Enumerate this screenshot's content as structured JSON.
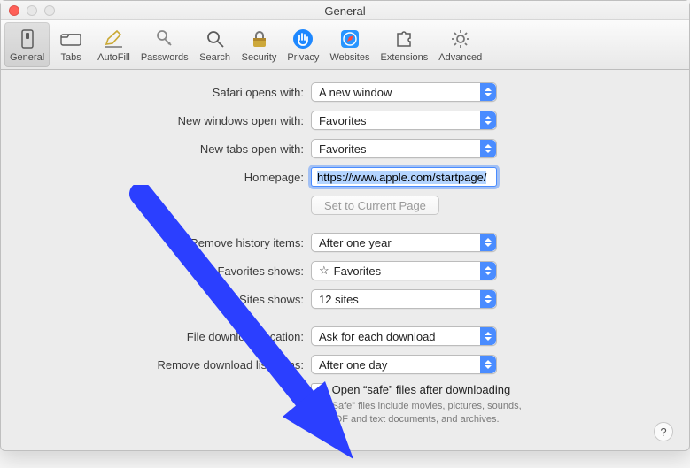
{
  "window": {
    "title": "General"
  },
  "toolbar": [
    {
      "name": "general",
      "label": "General"
    },
    {
      "name": "tabs",
      "label": "Tabs"
    },
    {
      "name": "autofill",
      "label": "AutoFill"
    },
    {
      "name": "passwords",
      "label": "Passwords"
    },
    {
      "name": "search",
      "label": "Search"
    },
    {
      "name": "security",
      "label": "Security"
    },
    {
      "name": "privacy",
      "label": "Privacy"
    },
    {
      "name": "websites",
      "label": "Websites"
    },
    {
      "name": "extensions",
      "label": "Extensions"
    },
    {
      "name": "advanced",
      "label": "Advanced"
    }
  ],
  "labels": {
    "safari_opens_with": "Safari opens with:",
    "new_windows_open": "New windows open with:",
    "new_tabs_open": "New tabs open with:",
    "homepage": "Homepage:",
    "set_current": "Set to Current Page",
    "remove_history": "Remove history items:",
    "favorites_shows": "Favorites shows:",
    "topsites_shows": "Top Sites shows:",
    "file_dl_location": "File download location:",
    "remove_dl_list": "Remove download list items:",
    "open_safe_files": "Open “safe” files after downloading",
    "safe_hint": "“Safe” files include movies, pictures, sounds, PDF and text documents, and archives."
  },
  "values": {
    "safari_opens_with": "A new window",
    "new_windows_open": "Favorites",
    "new_tabs_open": "Favorites",
    "homepage": "https://www.apple.com/startpage/",
    "remove_history": "After one year",
    "favorites_shows": "Favorites",
    "topsites_shows": "12 sites",
    "file_dl_location": "Ask for each download",
    "remove_dl_list": "After one day",
    "open_safe_checked": false
  },
  "help": "?"
}
